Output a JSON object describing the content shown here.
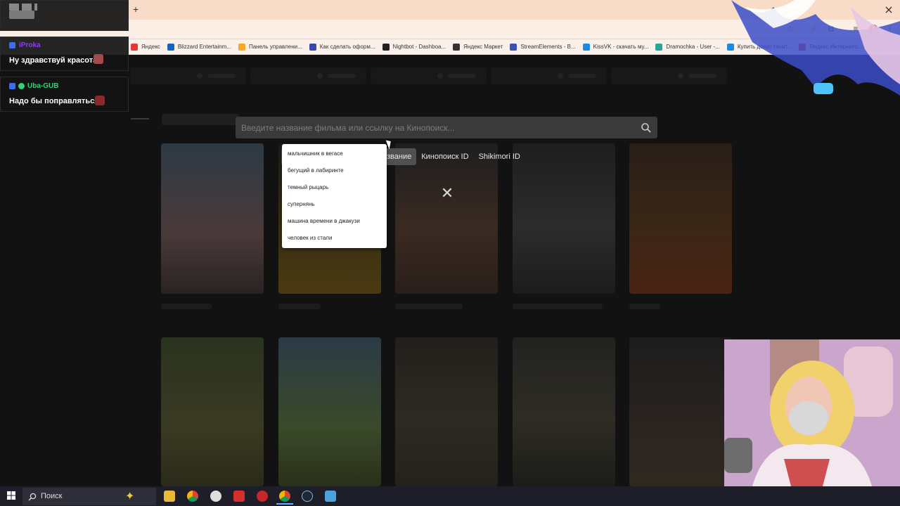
{
  "browser": {
    "bookmarks": [
      {
        "label": "Яндекс",
        "icon": "yandex-icon",
        "color": "#e53935"
      },
      {
        "label": "Blizzard Entertainm...",
        "icon": "blizzard-icon",
        "color": "#1565c0"
      },
      {
        "label": "Панель управлени...",
        "icon": "panel-icon",
        "color": "#f9a825"
      },
      {
        "label": "Как сделать оформ...",
        "icon": "letter-t-icon",
        "color": "#3949ab"
      },
      {
        "label": "Nightbot - Dashboa...",
        "icon": "nightbot-icon",
        "color": "#222222"
      },
      {
        "label": "Яндекс Маркет",
        "icon": "market-icon",
        "color": "#333333"
      },
      {
        "label": "StreamElements - B...",
        "icon": "streamelements-icon",
        "color": "#3f51b5"
      },
      {
        "label": "KissVK - скачать му...",
        "icon": "vk-icon",
        "color": "#1e88e5"
      },
      {
        "label": "Dramochka - User -...",
        "icon": "dramochka-icon",
        "color": "#26a69a"
      },
      {
        "label": "Купить донат Heart...",
        "icon": "letter-f-icon",
        "color": "#1e88e5"
      },
      {
        "label": "Яндекс Интернето...",
        "icon": "yandex-icon",
        "color": "#e53935"
      }
    ]
  },
  "search": {
    "placeholder": "Введите название фильма или ссылку на Кинопоиск...",
    "tabs": [
      {
        "label": "звание",
        "active": true
      },
      {
        "label": "Кинопоиск ID",
        "active": false
      },
      {
        "label": "Shikimori ID",
        "active": false
      }
    ],
    "suggestions": [
      "мальчишник в вегасе",
      "бегущий в лабиринте",
      "темный рыцарь",
      "супернянь",
      "машина времени в джакузи",
      "человек из стали"
    ]
  },
  "chat": {
    "messages": [
      {
        "user": "iProka",
        "user_color": "#8a3cff",
        "text": "Ну здравствуй красота"
      },
      {
        "user": "Uba-GUB",
        "user_color": "#33d17a",
        "text": "Надо бы поправляться"
      }
    ]
  },
  "taskbar": {
    "search_label": "Поиск"
  },
  "colors": {
    "tabstrip": "#f8dcc7",
    "page_bg": "#121212",
    "search_bg": "#3a3a3a",
    "accent_tab": "#505050"
  }
}
